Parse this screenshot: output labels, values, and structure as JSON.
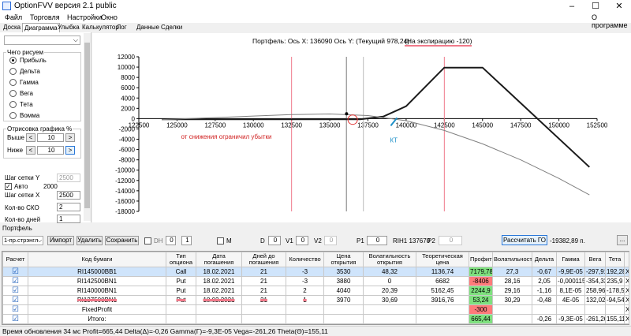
{
  "window": {
    "title": "OptionFVV версия 2.1 public",
    "min": "–",
    "max": "☐",
    "close": "✕"
  },
  "menu": {
    "items": [
      "Файл",
      "Торговля",
      "Настройки",
      "Окно"
    ],
    "about": "О программе"
  },
  "tabs": [
    "Доска",
    "Диаграмма",
    "Улыбка",
    "Калькулятор",
    "Лог",
    "Данные",
    "Сделки"
  ],
  "active_tab": 1,
  "left": {
    "group_title": "Чего рисуем",
    "options": [
      "Прибыль",
      "Дельта",
      "Гамма",
      "Вега",
      "Тета",
      "Вомма"
    ],
    "selected": 0,
    "plot_title": "Отрисовка графика %",
    "above_label": "Выше",
    "above_value": "10",
    "below_label": "Ниже",
    "below_value": "10",
    "prev": "<",
    "next": ">",
    "gridy_label": "Шаг сетки Y",
    "gridy_value": "2500",
    "auto_label": "Авто",
    "auto_value": "2000",
    "gridx_label": "Шаг сетки X",
    "gridx_value": "2500",
    "sko_label": "Кол-во СКО",
    "sko_value": "2",
    "days_label": "Кол-во дней",
    "days_value": "1"
  },
  "chart_header": {
    "text": "Портфель:  Ось X:  136090 Ось Y:   (Текущий 978,24)",
    "expiry": "(На экспирацию  -120)"
  },
  "chart_data": {
    "type": "line",
    "xlim": [
      122500,
      152500
    ],
    "ylim": [
      -18000,
      12000
    ],
    "x_ticks": [
      122500,
      125000,
      127500,
      130000,
      132500,
      135000,
      137500,
      140000,
      142500,
      145000,
      147500,
      150000,
      152500
    ],
    "x_tick_labels": [
      "122500",
      "125000",
      "127500",
      "130000",
      "132500",
      "135000",
      "137500",
      "140000",
      "142500",
      "145000",
      "147500",
      "150000",
      "152500"
    ],
    "y_ticks": [
      12000,
      10000,
      8000,
      6000,
      4000,
      2000,
      0,
      -2000,
      -4000,
      -6000,
      -8000,
      -10000,
      -12000,
      -14000,
      -16000,
      -18000
    ],
    "y_tick_labels": [
      "12000",
      "10000",
      "8000",
      "6000",
      "4000",
      "2000",
      "0",
      "-2000",
      "-4000",
      "-6000",
      "-8000",
      "-10000",
      "-12000",
      "-14000",
      "-16000",
      "-18000"
    ],
    "series": [
      {
        "x": [
          124000,
          137000,
          138500,
          140000,
          142500,
          145000,
          152000
        ],
        "y": [
          -120,
          -120,
          400,
          2400,
          9900,
          9900,
          -9400
        ],
        "color": "#1a1a1a"
      },
      {
        "x": [
          124000,
          127500,
          130000,
          132500,
          135000,
          137500,
          140000,
          142500,
          145000,
          147500,
          150000,
          152000
        ],
        "y": [
          -180,
          200,
          500,
          780,
          900,
          600,
          -400,
          -2300,
          -4900,
          -8000,
          -11600,
          -14800
        ],
        "color": "#808080"
      }
    ],
    "vlines": [
      {
        "x": 132500,
        "color": "#f07a8a"
      },
      {
        "x": 136090,
        "color": "#7a7a7a"
      },
      {
        "x": 137200,
        "color": "#bbbbbb"
      },
      {
        "x": 142500,
        "color": "#f07a8a"
      }
    ],
    "marker": {
      "x": 136100,
      "y": 950
    },
    "circle": {
      "x": 136500,
      "y": -200,
      "color": "#e03030"
    },
    "kt": {
      "x": 139200,
      "y": -600,
      "label": "КТ",
      "color": "#1e90c8"
    },
    "annotation": {
      "text": "от снижения ограничил убытки",
      "x": 131200,
      "y": -3900,
      "color": "#d02020"
    }
  },
  "portfolio_label": "Портфель",
  "toolbar": {
    "strategy": "1-пр.стрэнгл",
    "import": "Импорт",
    "delete": "Удалить",
    "save": "Сохранить",
    "dh": "DH",
    "dh_val1": "0",
    "dh_val2": "1",
    "m": "M",
    "d_label": "D",
    "d_val": "0",
    "v1_label": "V1",
    "v1_val": "0",
    "v2_label": "V2",
    "v2_val": "0",
    "p1_label": "P1",
    "p1_val": "0",
    "ri_label": "RIH1 137670",
    "p2_label": "P2",
    "p2_val": "0",
    "calc_go": "Рассчитать ГО",
    "go_value": "-19382,89 п.",
    "more": "..."
  },
  "table": {
    "headers": [
      "Расчет",
      "Код бумаги",
      "Тип опциона",
      "Дата погашения",
      "Дней до погашения",
      "Количество",
      "Цена открытия",
      "Волатильность открытия",
      "Теоретическая цена",
      "Профит",
      "Волатильность",
      "Дельта",
      "Гамма",
      "Вега",
      "Тета",
      ""
    ],
    "rows": [
      {
        "check": "☑",
        "code": "RI145000BB1",
        "type": "Call",
        "date": "18.02.2021",
        "days": "21",
        "qty": "-3",
        "price": "3530",
        "vol_open": "48,32",
        "theor": "1136,74",
        "profit": "7179,78",
        "pcls": "g",
        "vol": "27,3",
        "delta": "-0,67",
        "gamma": "-9,9E-05",
        "vega": "-297,91",
        "theta": "192,28",
        "x": "X"
      },
      {
        "check": "☑",
        "code": "RI142500BN1",
        "type": "Put",
        "date": "18.02.2021",
        "days": "21",
        "qty": "-3",
        "price": "3880",
        "vol_open": "0",
        "theor": "6682",
        "profit": "-8406",
        "pcls": "r",
        "vol": "28,16",
        "delta": "2,05",
        "gamma": "-0,000115",
        "vega": "-354,33",
        "theta": "235,9",
        "x": "X"
      },
      {
        "check": "☑",
        "code": "RI140000BN1",
        "type": "Put",
        "date": "18.02.2021",
        "days": "21",
        "qty": "2",
        "price": "4040",
        "vol_open": "20,39",
        "theor": "5162,45",
        "profit": "2244,9",
        "pcls": "g",
        "vol": "29,16",
        "delta": "-1,16",
        "gamma": "8,1E-05",
        "vega": "258,96",
        "theta": "-178,53",
        "x": "X"
      },
      {
        "check": "☑",
        "code": "RI137500BN1",
        "type": "Put",
        "date": "18.02.2021",
        "days": "21",
        "qty": "1",
        "price": "3970",
        "vol_open": "30,69",
        "theor": "3916,76",
        "profit": "53,24",
        "pcls": "g",
        "vol": "30,29",
        "delta": "-0,48",
        "gamma": "4E-05",
        "vega": "132,02",
        "theta": "-94,54",
        "x": "X"
      },
      {
        "check": "☑",
        "code": "FixedProfit",
        "type": "",
        "date": "",
        "days": "",
        "qty": "",
        "price": "",
        "vol_open": "",
        "theor": "",
        "profit": "-300",
        "pcls": "r",
        "vol": "",
        "delta": "",
        "gamma": "",
        "vega": "",
        "theta": "",
        "x": "X"
      },
      {
        "check": "☑",
        "code": "Итого:",
        "type": "",
        "date": "",
        "days": "",
        "qty": "",
        "price": "",
        "vol_open": "",
        "theor": "",
        "profit": "665,44",
        "pcls": "g",
        "vol": "",
        "delta": "-0,26",
        "gamma": "-9,3E-05",
        "vega": "-261,26",
        "theta": "155,11",
        "x": "X"
      }
    ]
  },
  "status": "Время обновления 34 мс  Profit=665,44 Delta(Δ)=-0,26 Gamma(Γ)=-9,3E-05 Vega=-261,26 Theta(Θ)=155,11"
}
